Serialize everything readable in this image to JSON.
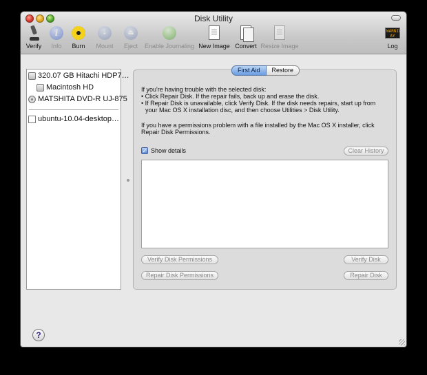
{
  "window": {
    "title": "Disk Utility"
  },
  "toolbar": {
    "items": [
      {
        "label": "Verify",
        "icon": "microscope-icon",
        "enabled": true
      },
      {
        "label": "Info",
        "icon": "info-icon",
        "enabled": false
      },
      {
        "label": "Burn",
        "icon": "burn-icon",
        "enabled": true
      },
      {
        "label": "Mount",
        "icon": "mount-icon",
        "enabled": false
      },
      {
        "label": "Eject",
        "icon": "eject-icon",
        "enabled": false
      },
      {
        "label": "Enable Journaling",
        "icon": "journaling-icon",
        "enabled": false
      },
      {
        "label": "New Image",
        "icon": "new-image-icon",
        "enabled": true
      },
      {
        "label": "Convert",
        "icon": "convert-icon",
        "enabled": true
      },
      {
        "label": "Resize Image",
        "icon": "resize-image-icon",
        "enabled": false
      },
      {
        "label": "Log",
        "icon": "log-icon",
        "enabled": true
      }
    ],
    "log_icon_text": "WARNING\nAY 7:36"
  },
  "sidebar": {
    "items": [
      {
        "label": "320.07 GB Hitachi HDP7…",
        "icon": "hard-disk-icon"
      },
      {
        "label": "Macintosh HD",
        "icon": "volume-icon"
      },
      {
        "label": "MATSHITA DVD-R UJ-875",
        "icon": "optical-drive-icon"
      },
      {
        "label": "ubuntu-10.04-desktop…",
        "icon": "disk-image-icon"
      }
    ]
  },
  "tabs": {
    "first_aid": "First Aid",
    "restore": "Restore",
    "active": "First Aid"
  },
  "first_aid": {
    "help_lines": [
      "If you're having trouble with the selected disk:",
      "• Click Repair Disk. If the repair fails, back up and erase the disk.",
      "• If Repair Disk is unavailable, click Verify Disk. If the disk needs repairs, start up from",
      "your Mac OS X installation disc, and then choose Utilities > Disk Utility.",
      "If you have a permissions problem with a file installed by the Mac OS X installer, click",
      "Repair Disk Permissions."
    ],
    "show_details_label": "Show details",
    "show_details_checked": true,
    "clear_history": "Clear History",
    "verify_permissions": "Verify Disk Permissions",
    "repair_permissions": "Repair Disk Permissions",
    "verify_disk": "Verify Disk",
    "repair_disk": "Repair Disk"
  },
  "help_button": "?"
}
